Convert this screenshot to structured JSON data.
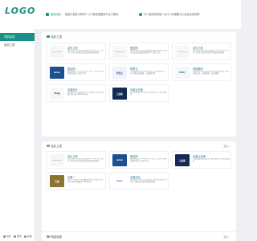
{
  "header": {
    "logo": "LOGO",
    "notice_label": "网站动态：",
    "notice_text": "想进行更多分析吗? 以下最佳数据库平台了解去",
    "question_text": "什么是网站导航? 为什么你需要它以及优化网站导"
  },
  "sidebar": {
    "items": [
      {
        "label": "导航目录"
      },
      {
        "label": "站长工具"
      }
    ],
    "footer": [
      {
        "label": "动态"
      },
      {
        "label": "首页"
      },
      {
        "label": "投放"
      }
    ]
  },
  "panel1": {
    "title": "站长工具",
    "sites": [
      {
        "name": "站长之家",
        "desc": "站长之家(中国站长站)创建于2002年, 是一家专门针对中文站长提供信息服务的网站",
        "thumb": ""
      },
      {
        "name": "爱站网",
        "desc": "爱站网站长工具提供网站收录查询和站长查询以及百度权重值查询等多个站长工具",
        "thumb": ""
      },
      {
        "name": "站长之家",
        "desc": "站长之家(中国站长站)创建于2002年, 是一家专门针对中文站长提供信息服务的网站",
        "thumb": ""
      },
      {
        "name": "爱站网",
        "desc": "爱站网成立于2009年, 是一家专门针对中文网站提供站长工具的平台",
        "thumb": "aizhan"
      },
      {
        "name": "阿里云",
        "desc": "阿里云全球领先的云计算及人工智能科技公司, 提供云服务器、云数据库等",
        "thumb": "阿里云"
      },
      {
        "name": "西部数码",
        "desc": "西部数码是国内领先的域名注册服务商, 提供虚拟主机、云服务器、企业邮箱",
        "thumb": "WEST"
      },
      {
        "name": "百度统计",
        "desc": "百度统计是百度推出的一款免费的专业网站流量分析工具, Baidu Tongji",
        "thumb": "Tongji"
      },
      {
        "name": "百度云加速",
        "desc": "百度云加速是百度旗下网站安全与性能加速服务",
        "thumb": "云加速"
      }
    ]
  },
  "panel2": {
    "title": "站长工具",
    "more": "更多 >",
    "sites": [
      {
        "name": "站长之家",
        "desc": "站长之家(中国站长站)创建于2002年, 是一家专门针对中文站长提供信息服务的网站",
        "thumb": ""
      },
      {
        "name": "爱站网",
        "desc": "爱站网成立于2009年, 是一家专门针对中文网站提供站长工具的平台",
        "thumb": "aizhan"
      },
      {
        "name": "百度云加速",
        "desc": "百度云加速是百度旗下网站安全与性能加速服务",
        "thumb": "云加速"
      },
      {
        "name": "天翼一",
        "desc": "天翼一(主题一), 使用最新的技术为站长们提供专业的主题服务, 2016年创",
        "thumb": "天翼"
      },
      {
        "name": "百度站长",
        "desc": "百度搜索资源平台是百度官方推出的站长工具平台, 帮助站长更好地优化网站",
        "thumb": "Baidu"
      }
    ]
  },
  "panel3": {
    "title": "网站动态",
    "more": "更多 >"
  }
}
